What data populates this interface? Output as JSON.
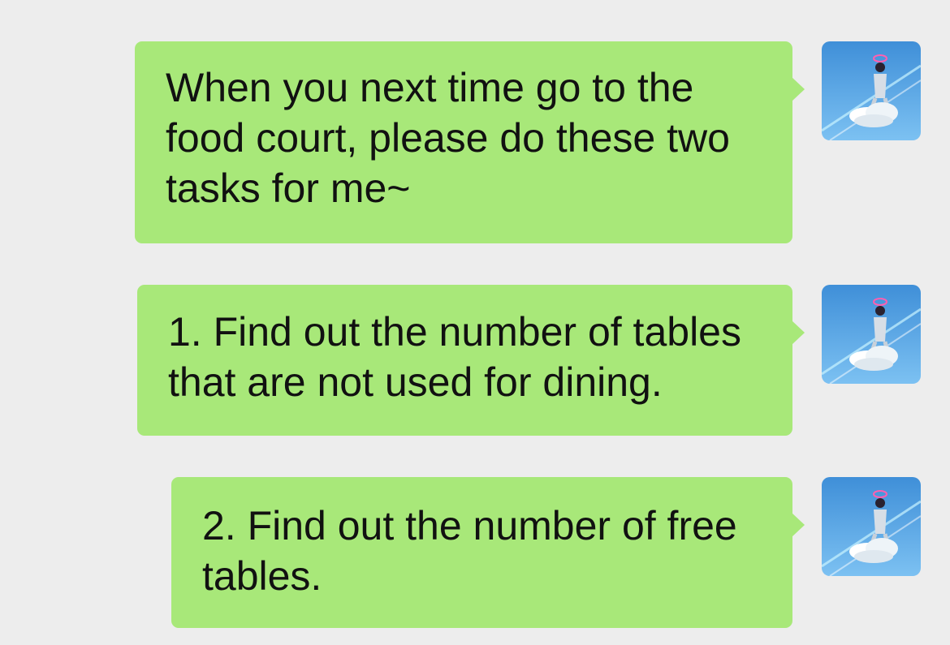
{
  "messages": [
    {
      "text": "When you next time go to the food court, please do these two tasks for me~",
      "avatar_icon": "angel-on-cloud-avatar-icon"
    },
    {
      "text": "1. Find out the number of tables that are not used for dining.",
      "avatar_icon": "angel-on-cloud-avatar-icon"
    },
    {
      "text": "2. Find out the number of free tables.",
      "avatar_icon": "angel-on-cloud-avatar-icon"
    }
  ],
  "colors": {
    "background": "#ededed",
    "bubble": "#a8e879",
    "text": "#111111",
    "avatar_sky": "#5aa7e8"
  }
}
